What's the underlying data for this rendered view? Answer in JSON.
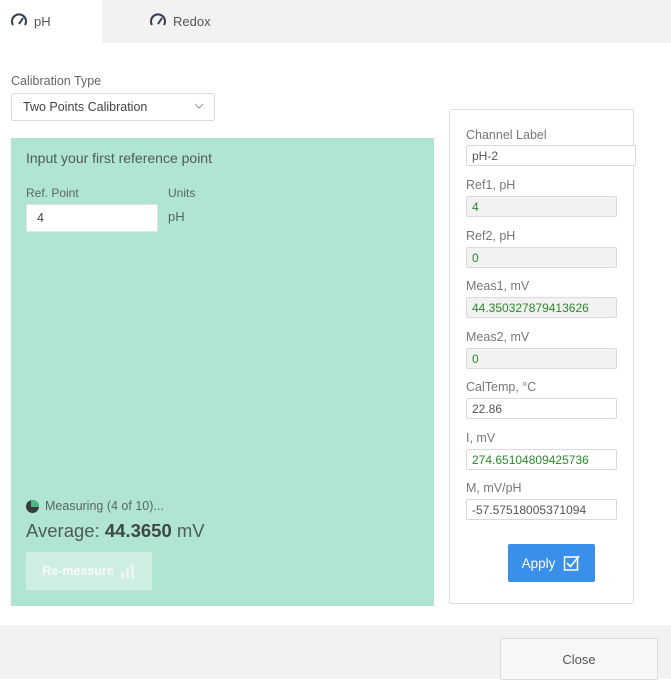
{
  "tabs": [
    {
      "label": "pH",
      "icon": "gauge-icon",
      "active": true
    },
    {
      "label": "Redox",
      "icon": "gauge-icon",
      "active": false
    }
  ],
  "calibration": {
    "label": "Calibration Type",
    "selected": "Two Points Calibration"
  },
  "step": {
    "title": "Input your first reference point",
    "ref_point_label": "Ref. Point",
    "ref_point_value": "4",
    "units_label": "Units",
    "units_value": "pH",
    "status": "Measuring (4 of 10)...",
    "average_prefix": "Average: ",
    "average_value": "44.3650",
    "average_unit": " mV",
    "remeasure_label": "Re-measure"
  },
  "results": {
    "channel_label": {
      "label": "Channel Label",
      "value": "pH-2"
    },
    "ref1": {
      "label": "Ref1, pH",
      "value": "4"
    },
    "ref2": {
      "label": "Ref2, pH",
      "value": "0"
    },
    "meas1": {
      "label": "Meas1, mV",
      "value": "44.350327879413626"
    },
    "meas2": {
      "label": "Meas2, mV",
      "value": "0"
    },
    "caltemp": {
      "label": "CalTemp, °C",
      "value": "22.86"
    },
    "intercept": {
      "label": "I, mV",
      "value": "274.65104809425736"
    },
    "slope": {
      "label": "M, mV/pH",
      "value": "-57.57518005371094"
    },
    "apply_label": "Apply"
  },
  "footer": {
    "close_label": "Close"
  },
  "colors": {
    "panel_green": "#b1e5d3",
    "apply_blue": "#3a8fe8",
    "value_green": "#2a8b2a"
  }
}
